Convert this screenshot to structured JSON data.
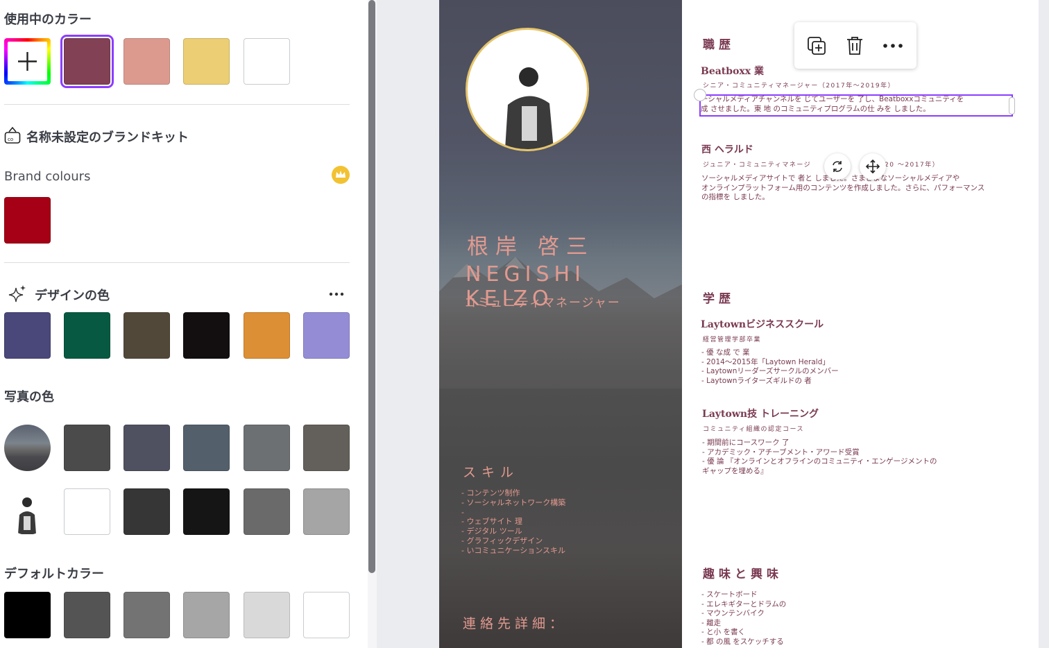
{
  "panel": {
    "used_colors_title": "使用中のカラー",
    "used_colors": [
      "#824155",
      "#dc9a8f",
      "#eccf74",
      "#ffffff"
    ],
    "add_color_label": "+",
    "brand_kit_title": "名称未設定のブランドキット",
    "brand_colours_title": "Brand colours",
    "brand_colours": [
      "#a50015"
    ],
    "design_colors_title": "デザインの色",
    "design_colors": [
      "#4a477b",
      "#075942",
      "#524839",
      "#130e10",
      "#dc8f34",
      "#948dd6"
    ],
    "photo_colors_title": "写真の色",
    "photo_colors_row1": [
      "#4b4b4b",
      "#4f5060",
      "#535f6a",
      "#6c7073",
      "#635f5a"
    ],
    "photo_colors_row2": [
      "#ffffff",
      "#363636",
      "#151515",
      "#6a6a6a",
      "#a5a5a5"
    ],
    "default_colors_title": "デフォルトカラー",
    "default_colors": [
      "#000000",
      "#545454",
      "#737373",
      "#a6a6a6",
      "#d9d9d9",
      "#ffffff"
    ]
  },
  "resume": {
    "name_jp": "根岸 啓三",
    "name_en": "NEGISHI KEIZO",
    "role": "コミュニティマネージャー",
    "skills_title": "スキル",
    "skills": [
      "- コンテンツ制作",
      "- ソーシャルネットワーク構築",
      "-",
      "- ウェブサイト 理",
      "- デジタル ツール",
      "- グラフィックデザイン",
      "- いコミュニケーションスキル"
    ],
    "contact_title": "連絡先詳細：",
    "career_title": "職歴",
    "job1_title": "Beatboxx 業",
    "job1_sub": "シニア・コミュニティマネージャー（2017年～2019年）",
    "job1_body_1": "ーシャルメディアチャンネルを じてユーザーを 了し、Beatboxxコミュニティを",
    "job1_body_2": "成 させました。東 地 のコミュニティプログラムの仕 みを しました。",
    "job2_title": "西 ヘラルド",
    "job2_sub": "ジュニア・コミュニティマネージ",
    "job2_sub_tail": "20 ～2017年）",
    "job2_body_1": "ソーシャルメディアサイトで 者と   しました。さまざまなソーシャルメディアや",
    "job2_body_2": "オンラインプラットフォーム用のコンテンツを作成しました。さらに、パフォーマンス",
    "job2_body_3": "の指標を しました。",
    "edu_title": "学歴",
    "edu1_title": "Laytownビジネススクール",
    "edu1_sub": "経営管理学部卒業",
    "edu1_items": [
      "- 優 な成 で 業",
      "- 2014～2015年「Laytown Herald」",
      "- Laytownリーダーズサークルのメンバー",
      "- Laytownライターズギルドの 者"
    ],
    "edu2_title": "Laytown技 トレーニング",
    "edu2_sub": "コミュニティ組織の認定コース",
    "edu2_items": [
      "- 期間前にコースワーク 了",
      "- アカデミック・アチーブメント・アワード受賞",
      "-  優 論 『オンラインとオフラインのコミュニティ・エンゲージメントの",
      "ギャップを埋める』"
    ],
    "hobby_title": "趣味と興味",
    "hobby_items": [
      "- スケートボード",
      "- エレキギターとドラムの",
      "- マウンテンバイク",
      "-   離走",
      "-  と小 を書く",
      "- 都 の風 をスケッチする"
    ]
  },
  "toolbar": {
    "duplicate_icon": "duplicate-icon",
    "delete_icon": "trash-icon",
    "more_icon": "more-icon"
  }
}
